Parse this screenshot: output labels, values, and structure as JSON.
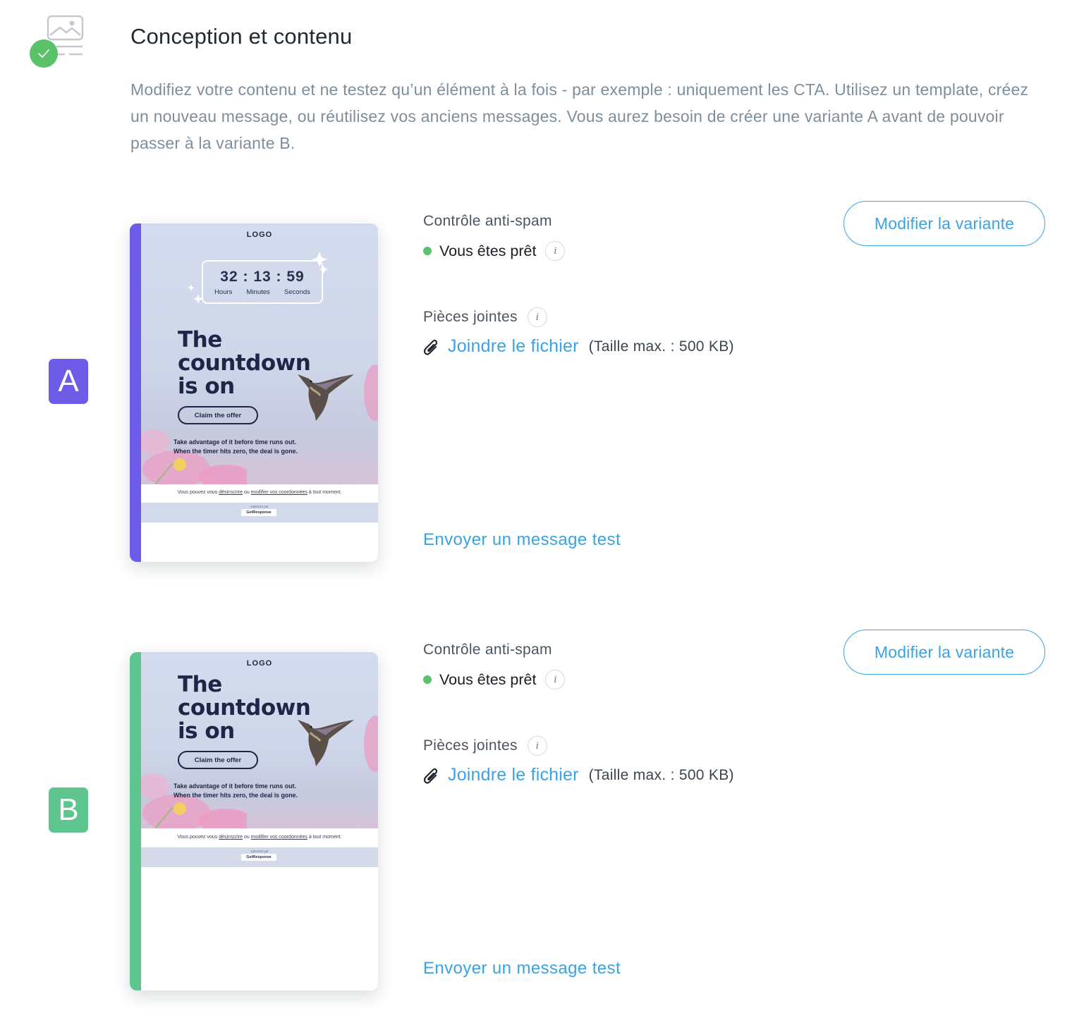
{
  "header": {
    "title": "Conception et contenu",
    "description": "Modifiez votre contenu et ne testez qu’un élément à la fois - par exemple : uniquement les CTA. Utilisez un template, créez un nouveau message, ou réutilisez vos anciens messages. Vous aurez besoin de créer une variante A avant de pouvoir passer à la variante B.",
    "status_icon": "check-icon",
    "section_icon": "image-layout-icon"
  },
  "colors": {
    "accent": "#3aa3e3",
    "success": "#5cc26a",
    "variant_a": "#6c5ce7",
    "variant_b": "#5fc58f"
  },
  "variants": [
    {
      "letter": "A",
      "preview": {
        "logo": "LOGO",
        "timer": "32 : 13 : 59",
        "timer_units": [
          "Hours",
          "Minutes",
          "Seconds"
        ],
        "headline_1": "The",
        "headline_2": "countdown",
        "headline_3": "is on",
        "cta": "Claim the offer",
        "copy_1": "Take advantage of it before time runs out.",
        "copy_2": "When the timer hits zero, the deal is gone.",
        "footer_pre": "Vous pouvez vous ",
        "footer_link1": "désinscrire",
        "footer_mid": " ou ",
        "footer_link2": "modifier vos coordonnées",
        "footer_post": " à tout moment.",
        "optimized": "Optimisé par",
        "brand": "GetResponse"
      },
      "spam_label": "Contrôle anti-spam",
      "spam_status": "Vous êtes prêt",
      "attachments_label": "Pièces jointes",
      "attach_link": "Joindre le fichier",
      "attach_size": "(Taille max. : 500 KB)",
      "send_test": "Envoyer un message test",
      "edit_button": "Modifier la variante"
    },
    {
      "letter": "B",
      "preview": {
        "logo": "LOGO",
        "headline_1": "The",
        "headline_2": "countdown",
        "headline_3": "is on",
        "cta": "Claim the offer",
        "copy_1": "Take advantage of it before time runs out.",
        "copy_2": "When the timer hits zero, the deal is gone.",
        "footer_pre": "Vous pouvez vous ",
        "footer_link1": "désinscrire",
        "footer_mid": " ou ",
        "footer_link2": "modifier vos coordonnées",
        "footer_post": " à tout moment.",
        "optimized": "Optimisé par",
        "brand": "GetResponse"
      },
      "spam_label": "Contrôle anti-spam",
      "spam_status": "Vous êtes prêt",
      "attachments_label": "Pièces jointes",
      "attach_link": "Joindre le fichier",
      "attach_size": "(Taille max. : 500 KB)",
      "send_test": "Envoyer un message test",
      "edit_button": "Modifier la variante"
    }
  ]
}
